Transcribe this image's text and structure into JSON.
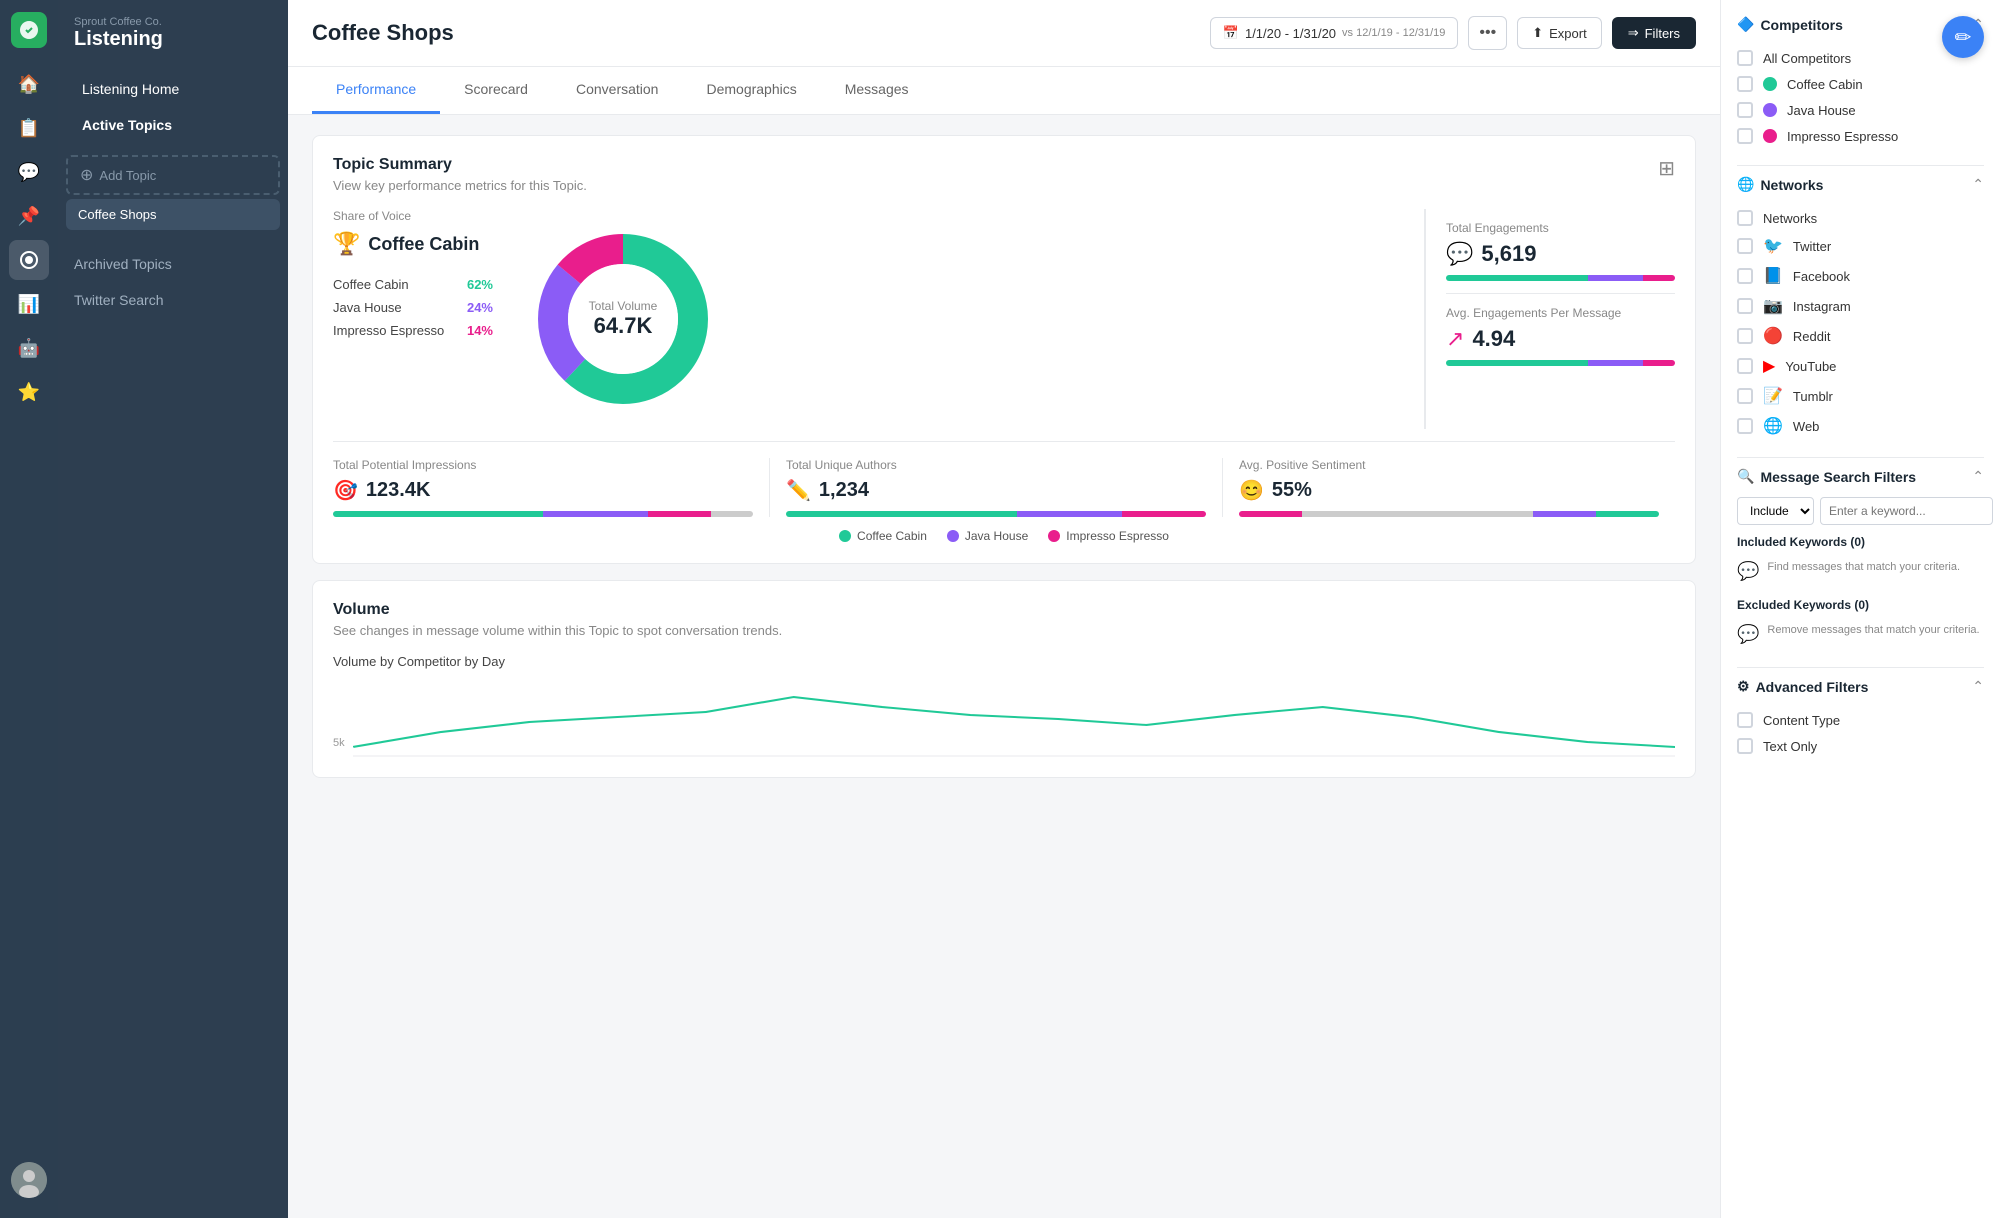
{
  "brand": {
    "company": "Sprout Coffee Co.",
    "app": "Listening"
  },
  "icon_nav": {
    "icons": [
      "🏠",
      "📋",
      "💬",
      "📌",
      "🎤",
      "📊",
      "🤖",
      "⭐"
    ]
  },
  "sidebar": {
    "listening_home": "Listening Home",
    "active_topics": "Active Topics",
    "add_topic": "Add Topic",
    "coffee_shops": "Coffee Shops",
    "archived_topics": "Archived Topics",
    "twitter_search": "Twitter Search"
  },
  "header": {
    "title": "Coffee Shops",
    "date_range": "1/1/20 - 1/31/20",
    "vs_date": "vs 12/1/19 - 12/31/19",
    "more": "•••",
    "export": "Export",
    "filters": "Filters"
  },
  "tabs": {
    "items": [
      "Performance",
      "Scorecard",
      "Conversation",
      "Demographics",
      "Messages"
    ],
    "active": 0
  },
  "topic_summary": {
    "title": "Topic Summary",
    "subtitle": "View key performance metrics for this Topic.",
    "share_of_voice_label": "Share of Voice",
    "winner": "Coffee Cabin",
    "competitors": [
      {
        "name": "Coffee Cabin",
        "pct": "62%",
        "color": "teal"
      },
      {
        "name": "Java House",
        "pct": "24%",
        "color": "purple"
      },
      {
        "name": "Impresso Espresso",
        "pct": "14%",
        "color": "pink"
      }
    ],
    "donut": {
      "total_label": "Total Volume",
      "total_value": "64.7K",
      "segments": [
        {
          "label": "Coffee Cabin",
          "pct": 62,
          "color": "#20c997"
        },
        {
          "label": "Java House",
          "pct": 24,
          "color": "#8b5cf6"
        },
        {
          "label": "Impresso Espresso",
          "pct": 14,
          "color": "#e91e8c"
        }
      ]
    },
    "metrics": [
      {
        "label": "Total Engagements",
        "icon": "💬",
        "icon_color": "#8b5cf6",
        "value": "5,619"
      },
      {
        "label": "Avg. Engagements Per Message",
        "icon": "↗",
        "icon_color": "#e91e8c",
        "value": "4.94"
      }
    ],
    "stats": [
      {
        "label": "Total Potential Impressions",
        "icon": "🎯",
        "icon_color": "#f59e0b",
        "value": "123.4K"
      },
      {
        "label": "Total Unique Authors",
        "icon": "✏️",
        "icon_color": "#3b82f6",
        "value": "1,234"
      },
      {
        "label": "Avg. Positive Sentiment",
        "icon": "😊",
        "icon_color": "#f59e0b",
        "value": "55%"
      }
    ],
    "legend": [
      {
        "label": "Coffee Cabin",
        "color": "#20c997"
      },
      {
        "label": "Java House",
        "color": "#8b5cf6"
      },
      {
        "label": "Impresso Espresso",
        "color": "#e91e8c"
      }
    ]
  },
  "volume": {
    "title": "Volume",
    "subtitle": "See changes in message volume within this Topic to spot conversation trends.",
    "chart_label": "Volume by Competitor by Day",
    "y_axis_label": "5k"
  },
  "right_panel": {
    "competitors_title": "Competitors",
    "all_competitors": "All Competitors",
    "competitors": [
      {
        "name": "Coffee Cabin",
        "color": "#20c997"
      },
      {
        "name": "Java House",
        "color": "#8b5cf6"
      },
      {
        "name": "Impresso Espresso",
        "color": "#e91e8c"
      }
    ],
    "networks_title": "Networks",
    "networks_label": "Networks",
    "networks": [
      {
        "name": "Twitter",
        "icon": "🐦",
        "color": "#1da1f2"
      },
      {
        "name": "Facebook",
        "icon": "📘",
        "color": "#1877f2"
      },
      {
        "name": "Instagram",
        "icon": "📷",
        "color": "#c13584"
      },
      {
        "name": "Reddit",
        "icon": "🔴",
        "color": "#ff4500"
      },
      {
        "name": "YouTube",
        "icon": "▶",
        "color": "#ff0000"
      },
      {
        "name": "Tumblr",
        "icon": "📝",
        "color": "#35465c"
      },
      {
        "name": "Web",
        "icon": "🌐",
        "color": "#888"
      }
    ],
    "message_search_title": "Message Search Filters",
    "keyword_placeholder": "Enter a keyword...",
    "include_label": "Include",
    "included_kw_title": "Included Keywords (0)",
    "included_kw_hint": "Find messages that match your criteria.",
    "excluded_kw_title": "Excluded Keywords (0)",
    "excluded_kw_hint": "Remove messages that match your criteria.",
    "advanced_filters_title": "Advanced Filters",
    "content_type_label": "Content Type",
    "text_only_label": "Text Only"
  }
}
